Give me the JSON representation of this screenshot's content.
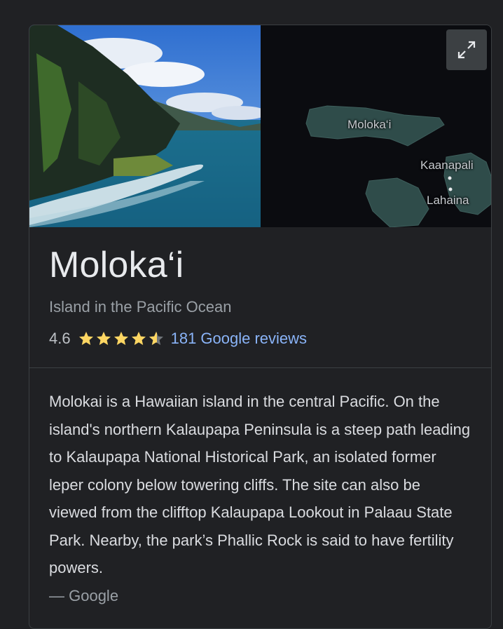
{
  "media": {
    "photo_alt": "Molokai sea cliffs",
    "map_labels": {
      "molokai": "Moloka‘i",
      "kaanapali": "Kaanapali",
      "lahaina": "Lahaina"
    },
    "expand_icon": "expand-icon"
  },
  "place": {
    "title": "Moloka‘i",
    "subtitle": "Island in the Pacific Ocean",
    "rating": "4.6",
    "stars": 4.6,
    "reviews_link": "181 Google reviews"
  },
  "description": {
    "text": "Molokai is a Hawaiian island in the central Pacific. On the island's northern Kalaupapa Peninsula is a steep path leading to Kalaupapa National Historical Park, an isolated former leper colony below towering cliffs. The site can also be viewed from the clifftop Kalaupapa Lookout in Palaau State Park. Nearby, the park’s Phallic Rock is said to have fertility powers.",
    "source": "— Google"
  },
  "colors": {
    "background": "#202124",
    "star": "#fdd663",
    "link": "#8ab4f8"
  }
}
